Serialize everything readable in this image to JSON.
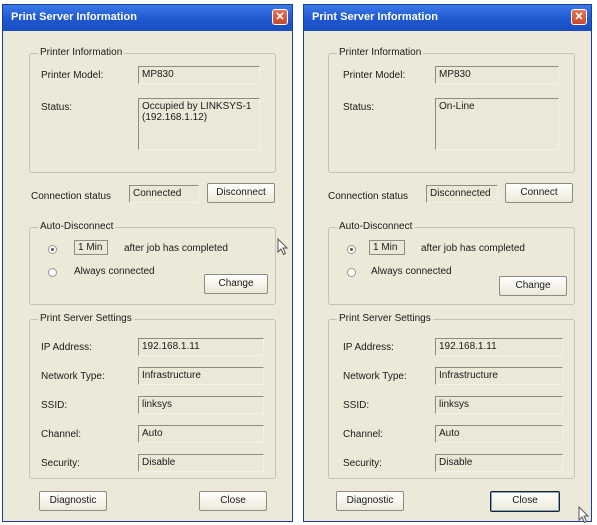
{
  "left": {
    "title": "Print Server Information",
    "close_glyph": "✕",
    "printer_info": {
      "legend": "Printer Information",
      "model_label": "Printer Model:",
      "model_value": "MP830",
      "status_label": "Status:",
      "status_value": "Occupied by LINKSYS-1\n(192.168.1.12)"
    },
    "connection": {
      "label": "Connection status",
      "value": "Connected",
      "button": "Disconnect"
    },
    "auto_disconnect": {
      "legend": "Auto-Disconnect",
      "minutes": "1 Min",
      "after_text": "after job has completed",
      "always_text": "Always connected",
      "change_button": "Change"
    },
    "settings": {
      "legend": "Print Server Settings",
      "ip_label": "IP Address:",
      "ip_value": "192.168.1.11",
      "network_label": "Network Type:",
      "network_value": "Infrastructure",
      "ssid_label": "SSID:",
      "ssid_value": "linksys",
      "channel_label": "Channel:",
      "channel_value": "Auto",
      "security_label": "Security:",
      "security_value": "Disable"
    },
    "diagnostic_button": "Diagnostic",
    "close_button": "Close"
  },
  "right": {
    "title": "Print Server Information",
    "close_glyph": "✕",
    "printer_info": {
      "legend": "Printer Information",
      "model_label": "Printer Model:",
      "model_value": "MP830",
      "status_label": "Status:",
      "status_value": "On-Line"
    },
    "connection": {
      "label": "Connection status",
      "value": "Disconnected",
      "button": "Connect"
    },
    "auto_disconnect": {
      "legend": "Auto-Disconnect",
      "minutes": "1 Min",
      "after_text": "after job has completed",
      "always_text": "Always connected",
      "change_button": "Change"
    },
    "settings": {
      "legend": "Print Server Settings",
      "ip_label": "IP Address:",
      "ip_value": "192.168.1.11",
      "network_label": "Network Type:",
      "network_value": "Infrastructure",
      "ssid_label": "SSID:",
      "ssid_value": "linksys",
      "channel_label": "Channel:",
      "channel_value": "Auto",
      "security_label": "Security:",
      "security_value": "Disable"
    },
    "diagnostic_button": "Diagnostic",
    "close_button": "Close"
  },
  "colors": {
    "titlebar": "#1f57cf",
    "window_bg": "#ece9d8",
    "close_button": "#c24a2a"
  },
  "icons": [
    "close-icon",
    "mouse-pointer-icon"
  ]
}
